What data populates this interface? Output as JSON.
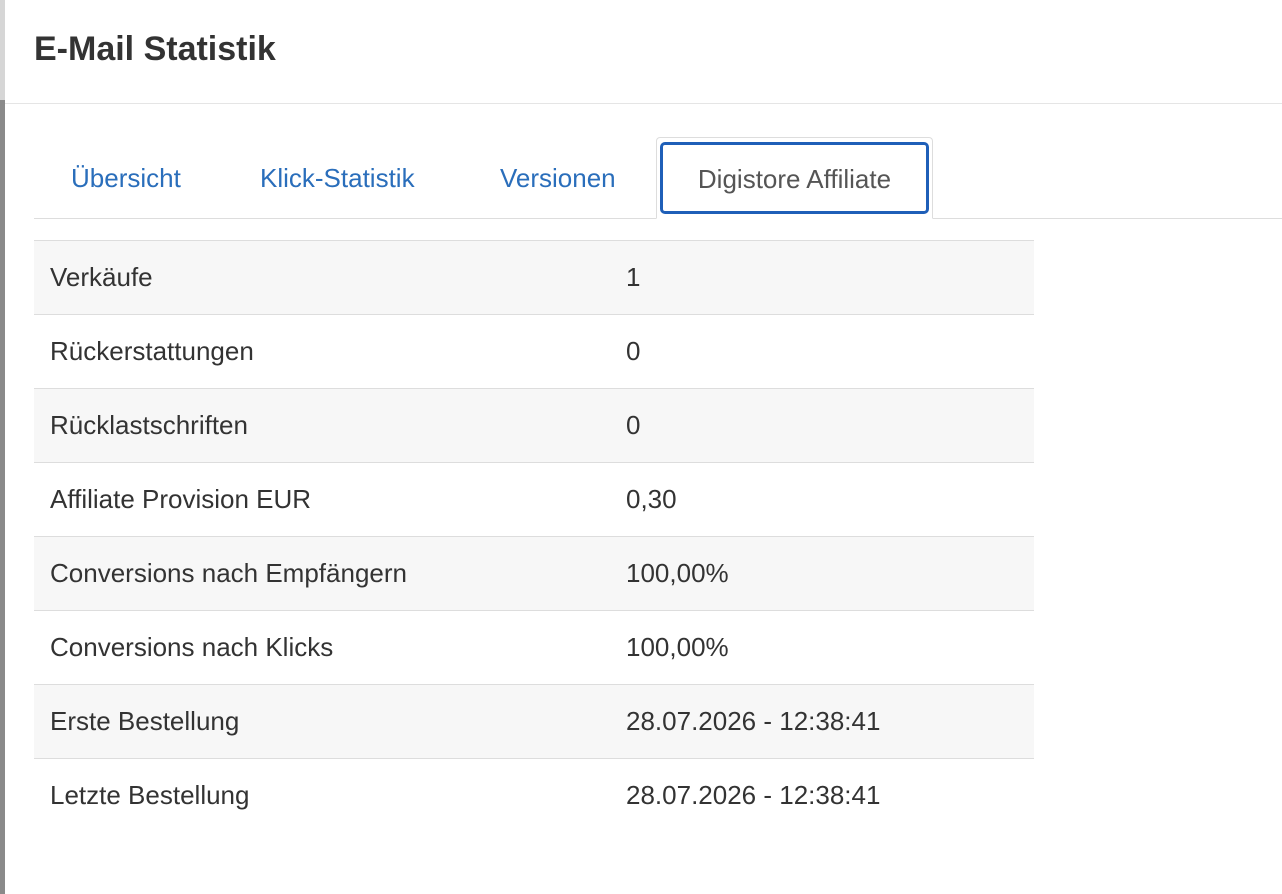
{
  "modal": {
    "title": "E-Mail Statistik"
  },
  "tabs": [
    {
      "label": "Übersicht",
      "active": false
    },
    {
      "label": "Klick-Statistik",
      "active": false
    },
    {
      "label": "Versionen",
      "active": false
    },
    {
      "label": "Digistore Affiliate",
      "active": true
    }
  ],
  "stats": [
    {
      "label": "Verkäufe",
      "value": "1"
    },
    {
      "label": "Rückerstattungen",
      "value": "0"
    },
    {
      "label": "Rücklastschriften",
      "value": "0"
    },
    {
      "label": "Affiliate Provision EUR",
      "value": "0,30"
    },
    {
      "label": "Conversions nach Empfängern",
      "value": "100,00%"
    },
    {
      "label": "Conversions nach Klicks",
      "value": "100,00%"
    },
    {
      "label": "Erste Bestellung",
      "value": "28.07.2026 - 12:38:41"
    },
    {
      "label": "Letzte Bestellung",
      "value": "28.07.2026 - 12:38:41"
    }
  ],
  "colors": {
    "link": "#2a6ebb",
    "focus": "#1f5fb8",
    "row_stripe": "#f7f7f7",
    "border": "#dddddd"
  }
}
